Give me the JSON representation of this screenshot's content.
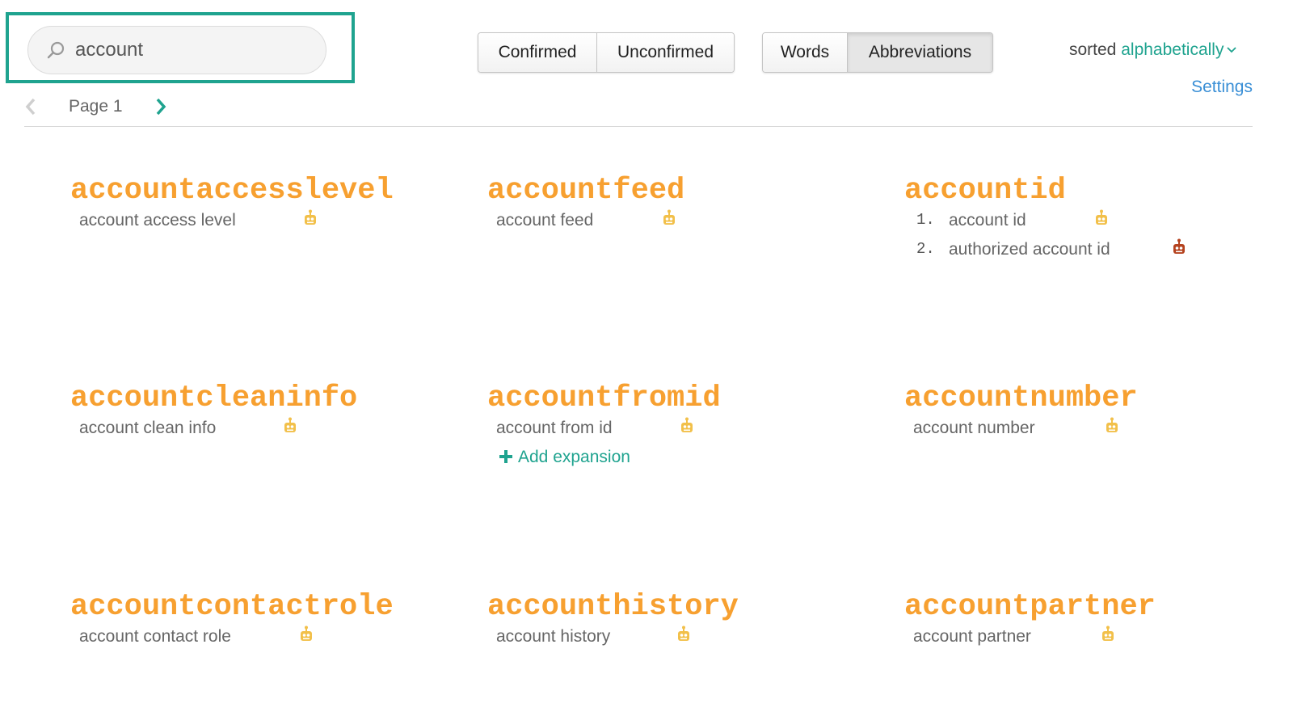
{
  "search": {
    "value": "account",
    "placeholder": ""
  },
  "filters": {
    "status": [
      {
        "label": "Confirmed",
        "active": false
      },
      {
        "label": "Unconfirmed",
        "active": false
      }
    ],
    "kind": [
      {
        "label": "Words",
        "active": false
      },
      {
        "label": "Abbreviations",
        "active": true
      }
    ]
  },
  "sort": {
    "prefix": "sorted",
    "value": "alphabetically"
  },
  "settings_label": "Settings",
  "pager": {
    "label": "Page 1"
  },
  "add_expansion_label": "Add expansion",
  "colors": {
    "accent": "#1fa38f",
    "title": "#f7a030",
    "robot_auto": "#f2c04a",
    "robot_alt": "#b5431f",
    "link": "#3a8fd6"
  },
  "entries": [
    {
      "title": "accountaccesslevel",
      "expansions": [
        "account access level"
      ]
    },
    {
      "title": "accountfeed",
      "expansions": [
        "account feed"
      ]
    },
    {
      "title": "accountid",
      "expansions": [
        "account id",
        "authorized account id"
      ],
      "numbers": [
        "1.",
        "2."
      ]
    },
    {
      "title": "accountcleaninfo",
      "expansions": [
        "account clean info"
      ]
    },
    {
      "title": "accountfromid",
      "expansions": [
        "account from id"
      ]
    },
    {
      "title": "accountnumber",
      "expansions": [
        "account number"
      ]
    },
    {
      "title": "accountcontactrole",
      "expansions": [
        "account contact role"
      ]
    },
    {
      "title": "accounthistory",
      "expansions": [
        "account history"
      ]
    },
    {
      "title": "accountpartner",
      "expansions": [
        "account partner"
      ]
    }
  ]
}
